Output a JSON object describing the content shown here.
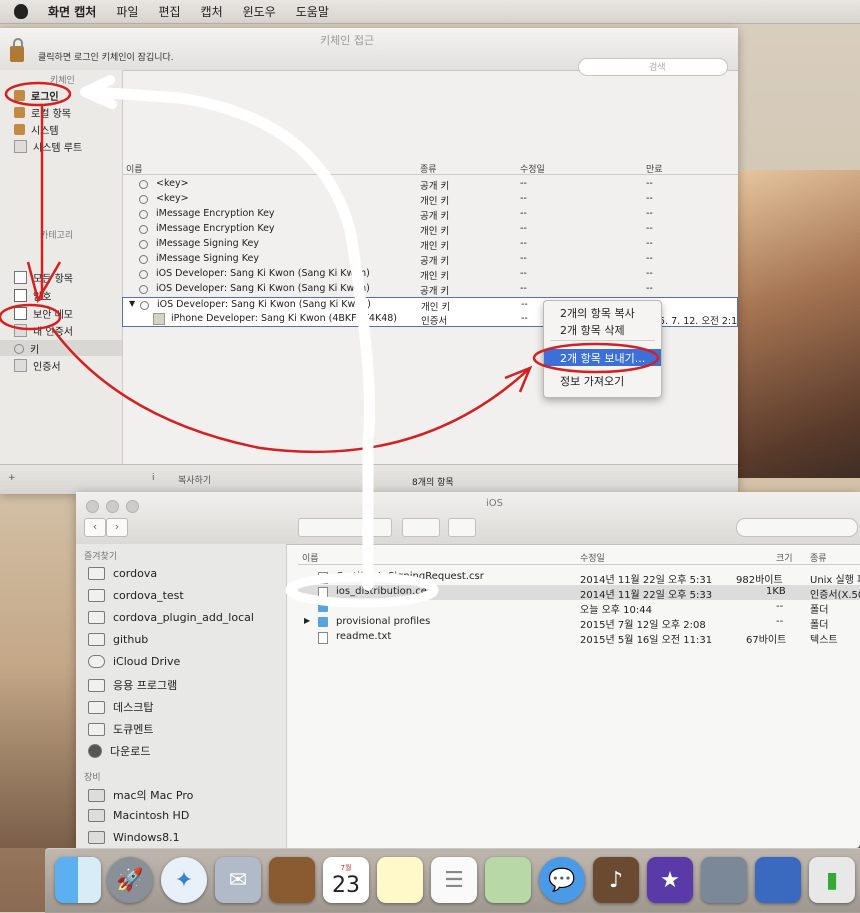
{
  "menubar": {
    "items": [
      "화면 캡처",
      "파일",
      "편집",
      "캡처",
      "윈도우",
      "도움말"
    ]
  },
  "keychain": {
    "title": "키체인 접근",
    "unlock_message": "클릭하면 로그인 키체인이 잠깁니다.",
    "search_placeholder": "검색",
    "keychains_header": "키체인",
    "keychains": [
      "로그인",
      "로컬 항목",
      "시스템",
      "시스템 루트"
    ],
    "category_header": "카테고리",
    "categories": [
      "모든 항목",
      "암호",
      "보안 메모",
      "내 인증서",
      "키",
      "인증서"
    ],
    "columns": [
      "이름",
      "종류",
      "수정일",
      "만료"
    ],
    "rows": [
      {
        "name": "<key>",
        "kind": "공개 키",
        "modified": "--",
        "expires": "--"
      },
      {
        "name": "<key>",
        "kind": "개인 키",
        "modified": "--",
        "expires": "--"
      },
      {
        "name": "iMessage Encryption Key",
        "kind": "공개 키",
        "modified": "--",
        "expires": "--"
      },
      {
        "name": "iMessage Encryption Key",
        "kind": "개인 키",
        "modified": "--",
        "expires": "--"
      },
      {
        "name": "iMessage Signing Key",
        "kind": "개인 키",
        "modified": "--",
        "expires": "--"
      },
      {
        "name": "iMessage Signing Key",
        "kind": "공개 키",
        "modified": "--",
        "expires": "--"
      },
      {
        "name": "iOS Developer: Sang Ki Kwon (Sang Ki Kwon)",
        "kind": "개인 키",
        "modified": "--",
        "expires": "--"
      },
      {
        "name": "iOS Developer: Sang Ki Kwon (Sang Ki Kwon)",
        "kind": "공개 키",
        "modified": "--",
        "expires": "--"
      }
    ],
    "selected_rows": [
      {
        "name": "iOS Developer: Sang Ki Kwon (Sang Ki Kwon)",
        "kind": "개인 키",
        "modified": "--",
        "expires": "--"
      },
      {
        "name": "iPhone Developer: Sang Ki Kwon (4BKFVY4K48)",
        "kind": "인증서",
        "modified": "--",
        "expires": "15. 7. 12. 오전 2:1"
      }
    ],
    "footer": {
      "add": "+",
      "info": "i",
      "copy": "복사하기",
      "count": "8개의 항목"
    }
  },
  "context_menu": {
    "items": [
      "2개의 항목 복사",
      "2개 항목 삭제",
      "2개 항목 보내기...",
      "정보 가져오기"
    ],
    "highlighted": "2개 항목 보내기..."
  },
  "finder": {
    "title": "iOS",
    "favorites_header": "즐겨찾기",
    "favorites": [
      "cordova",
      "cordova_test",
      "cordova_plugin_add_local",
      "github",
      "iCloud Drive",
      "응용 프로그램",
      "데스크탑",
      "도큐멘트",
      "다운로드"
    ],
    "devices_header": "장비",
    "devices": [
      "mac의 Mac Pro",
      "Macintosh HD",
      "Windows8.1"
    ],
    "columns": [
      "이름",
      "수정일",
      "크기",
      "종류"
    ],
    "rows": [
      {
        "name": "CertificateSigningRequest.csr",
        "date": "2014년 11월 22일 오후 5:31",
        "size": "982바이트",
        "kind": "Unix 실행 파"
      },
      {
        "name": "ios_distribution.cer",
        "date": "2014년 11월 22일 오후 5:33",
        "size": "1KB",
        "kind": "인증서(X.50"
      },
      {
        "name": "",
        "date": "오늘 오후 10:44",
        "size": "--",
        "kind": "폴더"
      },
      {
        "name": "provisional profiles",
        "date": "2015년 7월 12일 오후 2:08",
        "size": "--",
        "kind": "폴더"
      },
      {
        "name": "readme.txt",
        "date": "2015년 5월 16일 오전 11:31",
        "size": "67바이트",
        "kind": "텍스트"
      }
    ]
  },
  "dock": {
    "calendar_day": "23",
    "calendar_month": "7월"
  },
  "colors": {
    "annotation_red": "#d42020",
    "selection_blue": "#3c70d8"
  }
}
